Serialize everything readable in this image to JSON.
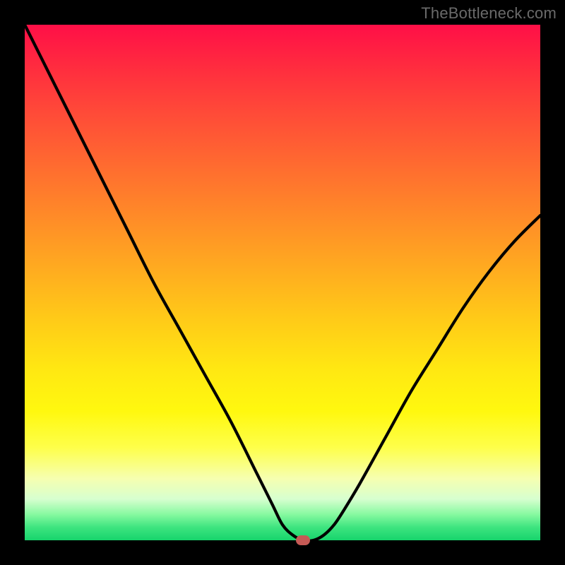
{
  "watermark": "TheBottleneck.com",
  "colors": {
    "background": "#000000",
    "curve_stroke": "#000000",
    "marker_fill": "#c65a55"
  },
  "chart_data": {
    "type": "line",
    "title": "",
    "xlabel": "",
    "ylabel": "",
    "xlim": [
      0,
      100
    ],
    "ylim": [
      0,
      100
    ],
    "grid": false,
    "legend": null,
    "series": [
      {
        "name": "bottleneck-curve",
        "x": [
          0,
          5,
          10,
          15,
          20,
          25,
          30,
          35,
          40,
          45,
          48,
          50,
          52,
          54,
          56,
          58,
          60,
          62,
          65,
          70,
          75,
          80,
          85,
          90,
          95,
          100
        ],
        "y": [
          100,
          90,
          80,
          70,
          60,
          50,
          41,
          32,
          23,
          13,
          7,
          3,
          1,
          0,
          0,
          1,
          3,
          6,
          11,
          20,
          29,
          37,
          45,
          52,
          58,
          63
        ]
      }
    ],
    "marker": {
      "x": 54,
      "y": 0
    },
    "annotations": []
  }
}
